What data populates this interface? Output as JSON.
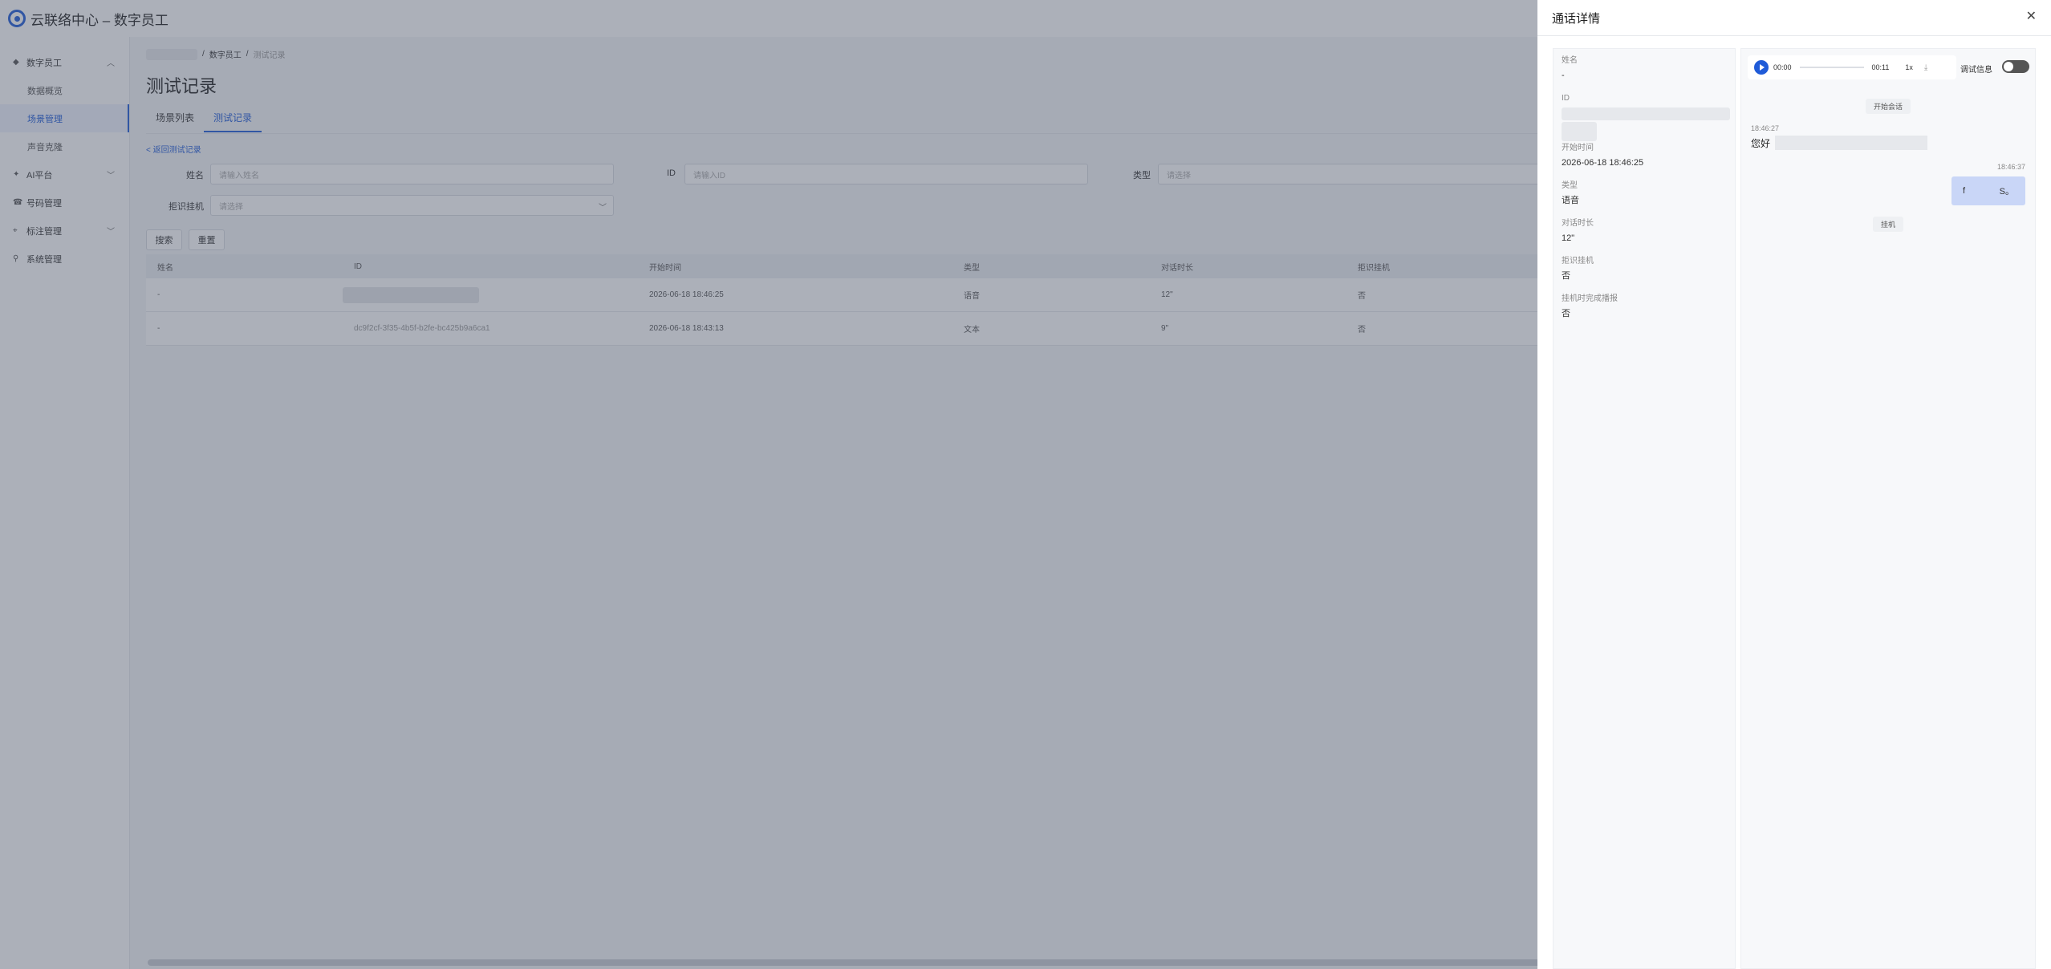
{
  "app": {
    "title": "云联络中心 – 数字员工"
  },
  "sidebar": {
    "groups": [
      {
        "label": "数字员工",
        "icon": "robot-icon",
        "chevron": "chevron-up-icon",
        "items": [
          "数据概览",
          "场景管理",
          "声音克隆"
        ]
      },
      {
        "label": "AI平台",
        "icon": "ai-icon",
        "chevron": "chevron-down-icon"
      },
      {
        "label": "号码管理",
        "icon": "phone-icon"
      },
      {
        "label": "标注管理",
        "icon": "tag-icon",
        "chevron": "chevron-down-icon"
      },
      {
        "label": "系统管理",
        "icon": "search-icon"
      }
    ],
    "active_item": "场景管理"
  },
  "breadcrumb": {
    "sep": "/",
    "parent": "数字员工",
    "current": "测试记录"
  },
  "page": {
    "title": "测试记录",
    "tabs": [
      "场景列表",
      "测试记录"
    ],
    "active_tab": "测试记录",
    "back_link": "< 返回测试记录"
  },
  "filters": {
    "name_label": "姓名",
    "name_placeholder": "请输入姓名",
    "id_label": "ID",
    "id_placeholder": "请输入ID",
    "type_label": "类型",
    "type_placeholder": "请选择",
    "hangup_label": "拒识挂机",
    "hangup_placeholder": "请选择",
    "search_btn": "搜索",
    "reset_btn": "重置"
  },
  "table": {
    "headers": [
      "姓名",
      "ID",
      "开始时间",
      "类型",
      "对话时长",
      "拒识挂机"
    ],
    "rows": [
      {
        "name": "-",
        "id": "",
        "start": "2026-06-18 18:46:25",
        "type": "语音",
        "duration": "12\"",
        "hangup": "否"
      },
      {
        "name": "-",
        "id": "dc9f2cf-3f35-4b5f-b2fe-bc425b9a6ca1",
        "start": "2026-06-18 18:43:13",
        "type": "文本",
        "duration": "9\"",
        "hangup": "否"
      }
    ]
  },
  "drawer": {
    "title": "通话详情",
    "info": [
      {
        "label": "姓名",
        "value": "-"
      },
      {
        "label": "ID",
        "value": ""
      },
      {
        "label": "开始时间",
        "value": "2026-06-18 18:46:25"
      },
      {
        "label": "类型",
        "value": "语音"
      },
      {
        "label": "对话时长",
        "value": "12\""
      },
      {
        "label": "拒识挂机",
        "value": "否"
      },
      {
        "label": "挂机时完成播报",
        "value": "否"
      }
    ],
    "player": {
      "current": "00:00",
      "total": "00:11",
      "speed": "1x",
      "progress": 0
    },
    "debug_label": "调试信息",
    "chat": {
      "start": "开始会话",
      "left_time": "18:46:27",
      "left_text": "您好",
      "right_time": "18:46:37",
      "right_text_a": "f",
      "right_text_b": "S。",
      "end": "挂机"
    }
  }
}
